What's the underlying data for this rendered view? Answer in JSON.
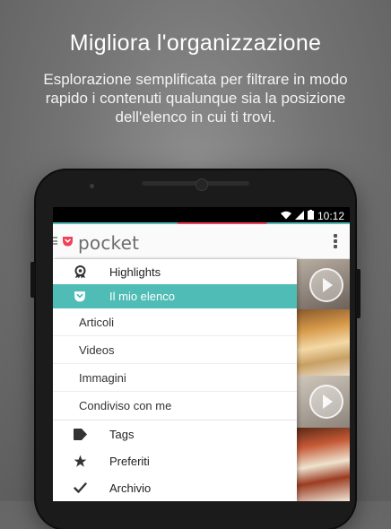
{
  "promo": {
    "headline": "Migliora l'organizzazione",
    "subtext": "Esplorazione semplificata per filtrare in modo rapido i contenuti qualunque sia la posizione dell'elenco in cui ti trovi."
  },
  "status_bar": {
    "time": "10:12",
    "icons": [
      "wifi-icon",
      "signal-icon",
      "battery-icon"
    ]
  },
  "app_bar": {
    "app_name": "pocket",
    "overflow_icon": "overflow-menu-icon"
  },
  "drawer": {
    "highlights": {
      "label": "Highlights",
      "icon": "highlights-icon"
    },
    "my_list": {
      "label": "Il mio elenco",
      "icon": "pocket-icon",
      "selected": true
    },
    "sub_items": [
      "Articoli",
      "Videos",
      "Immagini",
      "Condiviso con me"
    ],
    "tags": {
      "label": "Tags",
      "icon": "tag-icon"
    },
    "favorites": {
      "label": "Preferiti",
      "icon": "star-icon"
    },
    "archive": {
      "label": "Archivio",
      "icon": "check-icon"
    }
  },
  "colors": {
    "accent": "#50bcb6",
    "brand": "#ef4056"
  }
}
